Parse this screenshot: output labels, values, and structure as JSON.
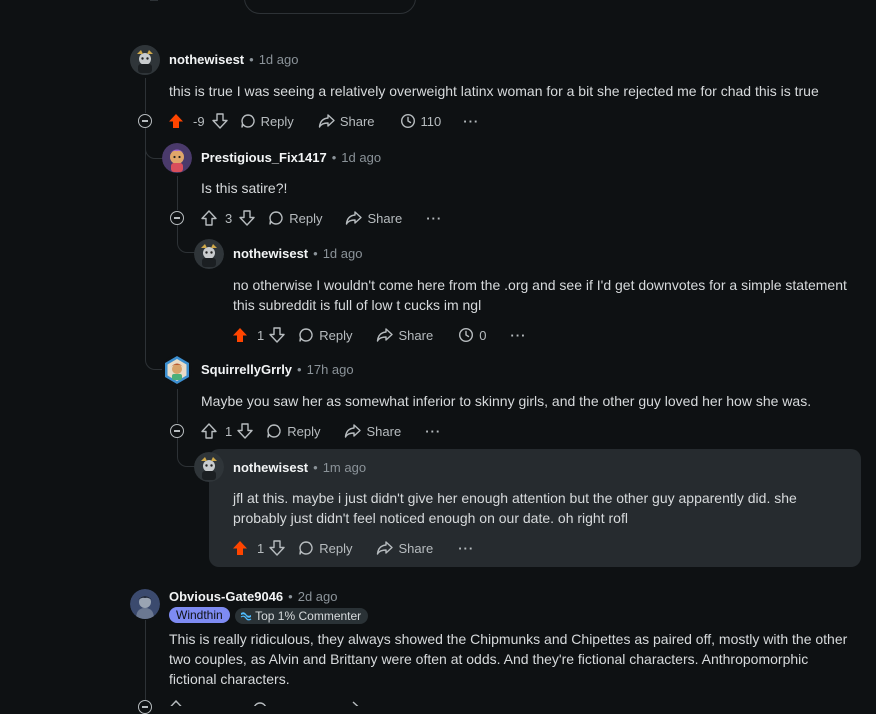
{
  "comments": [
    {
      "user": "nothewisest",
      "time": "1d ago",
      "body": [
        "this is true I was seeing a relatively overweight latinx woman for a bit she rejected me for chad this is true"
      ],
      "score": "-9",
      "reply": "Reply",
      "share": "Share",
      "awards": "110",
      "upvoted": true
    },
    {
      "user": "Prestigious_Fix1417",
      "time": "1d ago",
      "body": [
        "Is this satire?!"
      ],
      "score": "3",
      "reply": "Reply",
      "share": "Share",
      "upvoted": false
    },
    {
      "user": "nothewisest",
      "time": "1d ago",
      "body": [
        "no otherwise I wouldn't come here from the .org and see if I'd get downvotes for a simple statement",
        "this subreddit is full of low t cucks im ngl"
      ],
      "score": "1",
      "reply": "Reply",
      "share": "Share",
      "awards": "0",
      "upvoted": true
    },
    {
      "user": "SquirrellyGrrly",
      "time": "17h ago",
      "body": [
        "Maybe you saw her as somewhat inferior to skinny girls, and the other guy loved her how she was."
      ],
      "score": "1",
      "reply": "Reply",
      "share": "Share",
      "upvoted": false
    },
    {
      "user": "nothewisest",
      "time": "1m ago",
      "body": [
        "jfl at this. maybe i just didn't give her enough attention but the other guy apparently did. she",
        "probably just didn't feel noticed enough on our date. oh right rofl"
      ],
      "score": "1",
      "reply": "Reply",
      "share": "Share",
      "upvoted": true
    },
    {
      "user": "Obvious-Gate9046",
      "time": "2d ago",
      "flair": "Windthin",
      "top_badge": "Top 1% Commenter",
      "body": [
        "This is really ridiculous, they always showed the Chipmunks and Chipettes as paired off, mostly with the other",
        "two couples, as Alvin and Brittany were often at odds. And they're fictional characters. Anthropomorphic",
        "fictional characters."
      ]
    }
  ],
  "more_label": "···",
  "colors": {
    "upvote": "#ff4500",
    "background": "#0e1113",
    "highlight": "#262b2f",
    "flair": "#7e8bf2"
  }
}
